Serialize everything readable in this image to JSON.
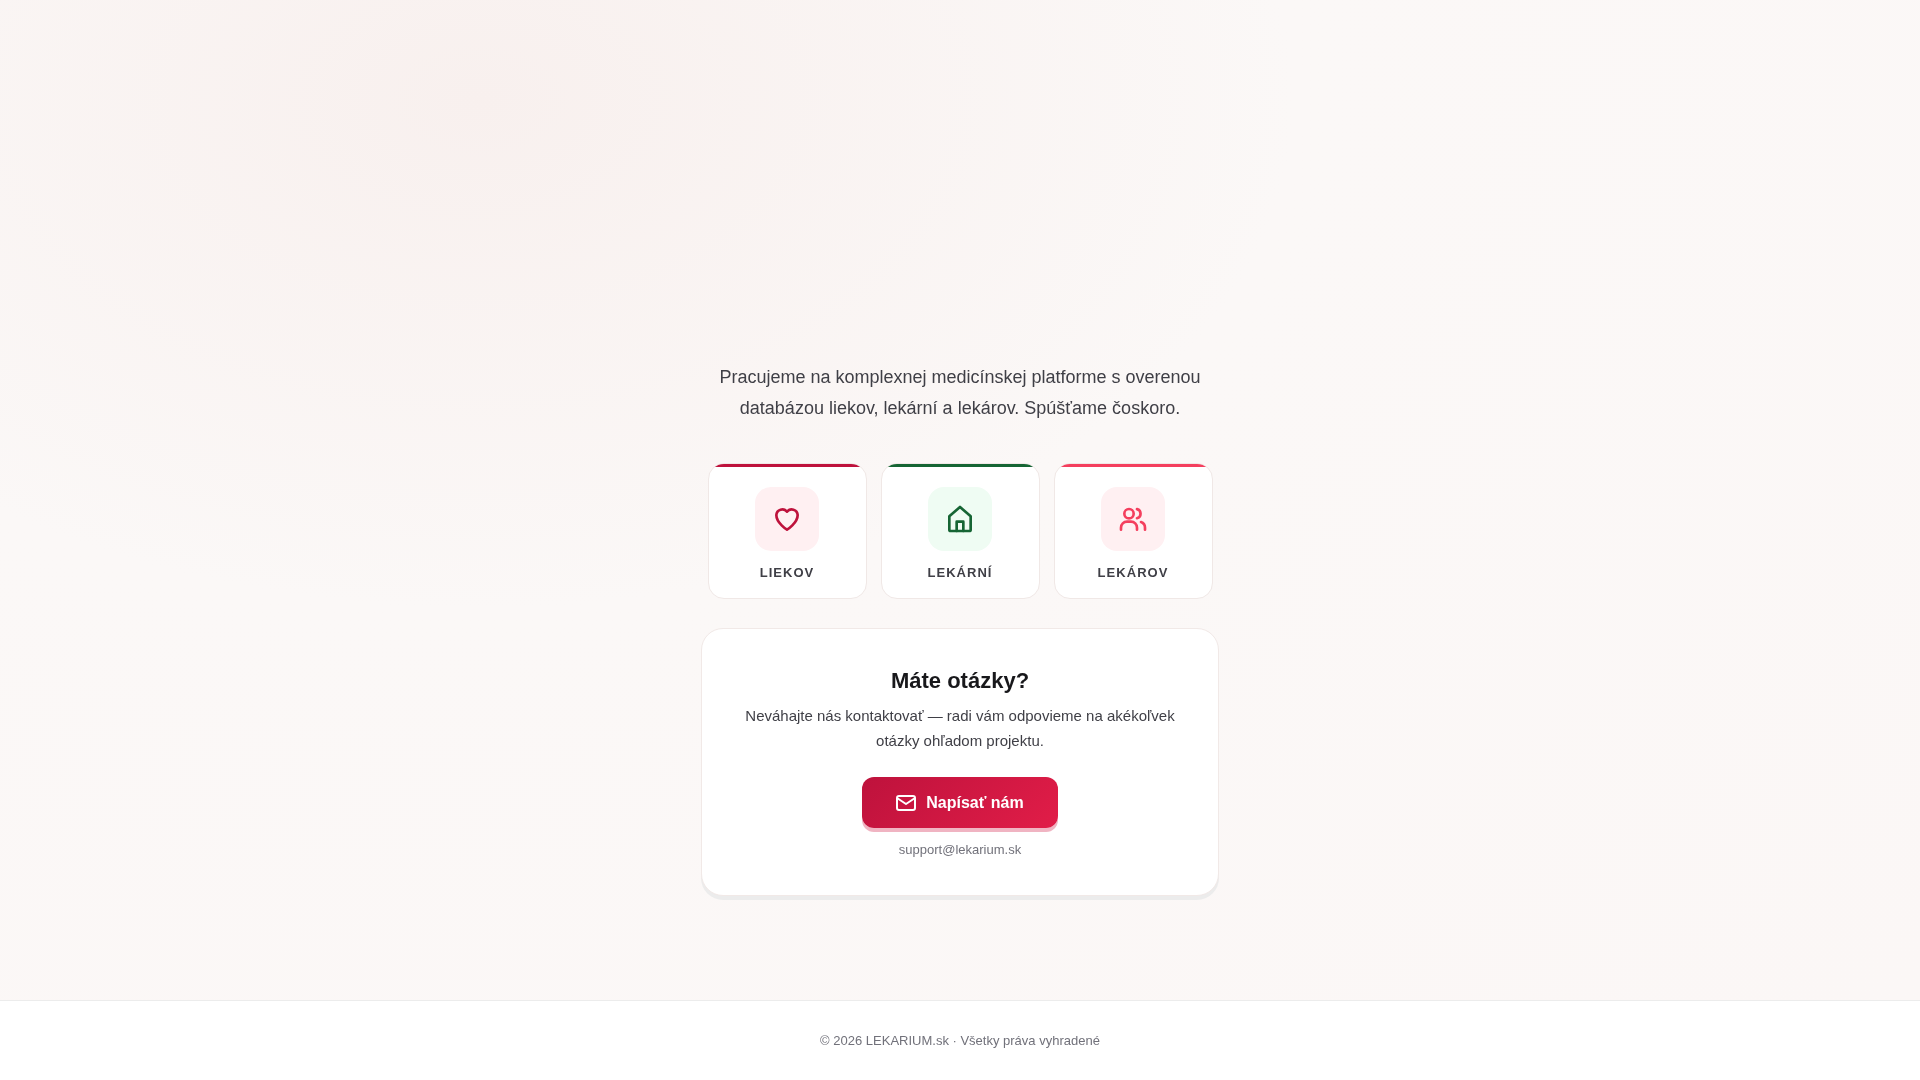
{
  "intro": "Pracujeme na komplexnej medicínskej platforme s overenou databázou liekov, lekární a lekárov. Spúšťame čoskoro.",
  "cards": [
    {
      "label": "LIEKOV",
      "kind": "heart",
      "color": "#be123c"
    },
    {
      "label": "LEKÁRNÍ",
      "kind": "house",
      "color": "#166534"
    },
    {
      "label": "LEKÁROV",
      "kind": "users",
      "color": "#f43f5e"
    }
  ],
  "contact": {
    "title": "Máte otázky?",
    "text": "Neváhajte nás kontaktovať — radi vám odpovieme na akékoľvek otázky ohľadom projektu.",
    "button": "Napísať nám",
    "email": "support@lekarium.sk"
  },
  "footer": "© 2026 LEKARIUM.sk · Všetky práva vyhradené"
}
